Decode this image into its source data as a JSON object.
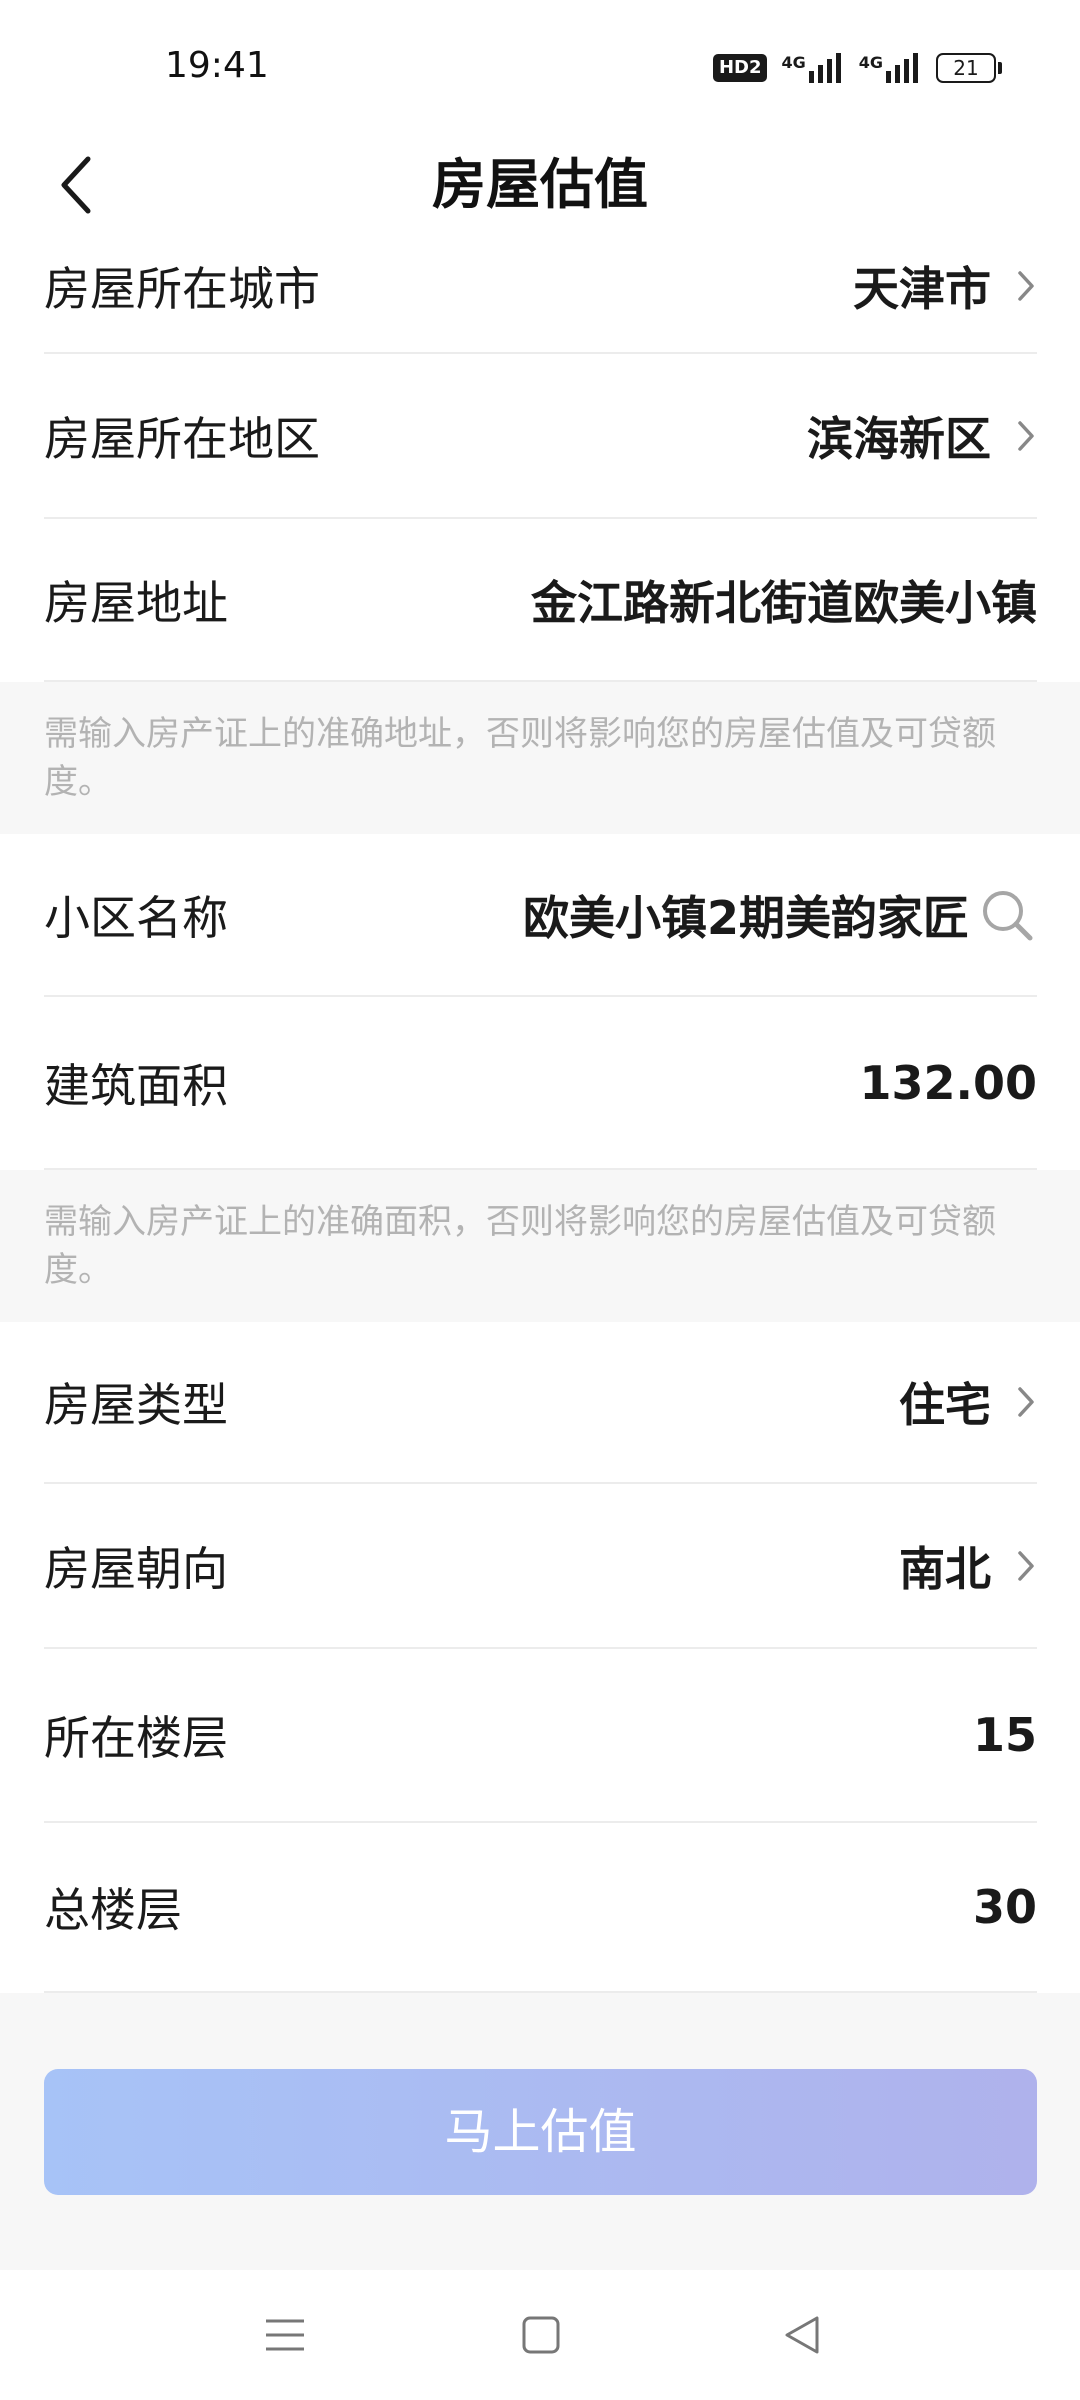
{
  "status_bar": {
    "time": "19:41",
    "hd_badge": "HD2",
    "network_1": "4G",
    "network_2": "4G",
    "battery": "21",
    "icons": [
      "hd-icon",
      "signal-icon",
      "signal-icon",
      "battery-icon"
    ]
  },
  "header": {
    "title": "房屋估值",
    "back_icon": "chevron-left-icon"
  },
  "form": {
    "city": {
      "label": "房屋所在城市",
      "value": "天津市"
    },
    "district": {
      "label": "房屋所在地区",
      "value": "滨海新区"
    },
    "address": {
      "label": "房屋地址",
      "value": "金江路新北街道欧美小镇"
    },
    "address_note": "需输入房产证上的准确地址，否则将影响您的房屋估值及可贷额度。",
    "community": {
      "label": "小区名称",
      "value": "欧美小镇2期美韵家匠"
    },
    "area": {
      "label": "建筑面积",
      "value": "132.00"
    },
    "area_note": "需输入房产证上的准确面积，否则将影响您的房屋估值及可贷额度。",
    "type": {
      "label": "房屋类型",
      "value": "住宅"
    },
    "orientation": {
      "label": "房屋朝向",
      "value": "南北"
    },
    "floor": {
      "label": "所在楼层",
      "value": "15"
    },
    "total_floors": {
      "label": "总楼层",
      "value": "30"
    }
  },
  "submit_label": "马上估值",
  "colors": {
    "button_gradient_start": "#a7c3f7",
    "button_gradient_end": "#afb2ec",
    "note_text": "#b3b3b3",
    "note_bg": "#f7f7f7",
    "divider": "#ececec"
  },
  "nav_bar": {
    "icons": [
      "menu-icon",
      "home-square-icon",
      "back-triangle-icon"
    ]
  }
}
